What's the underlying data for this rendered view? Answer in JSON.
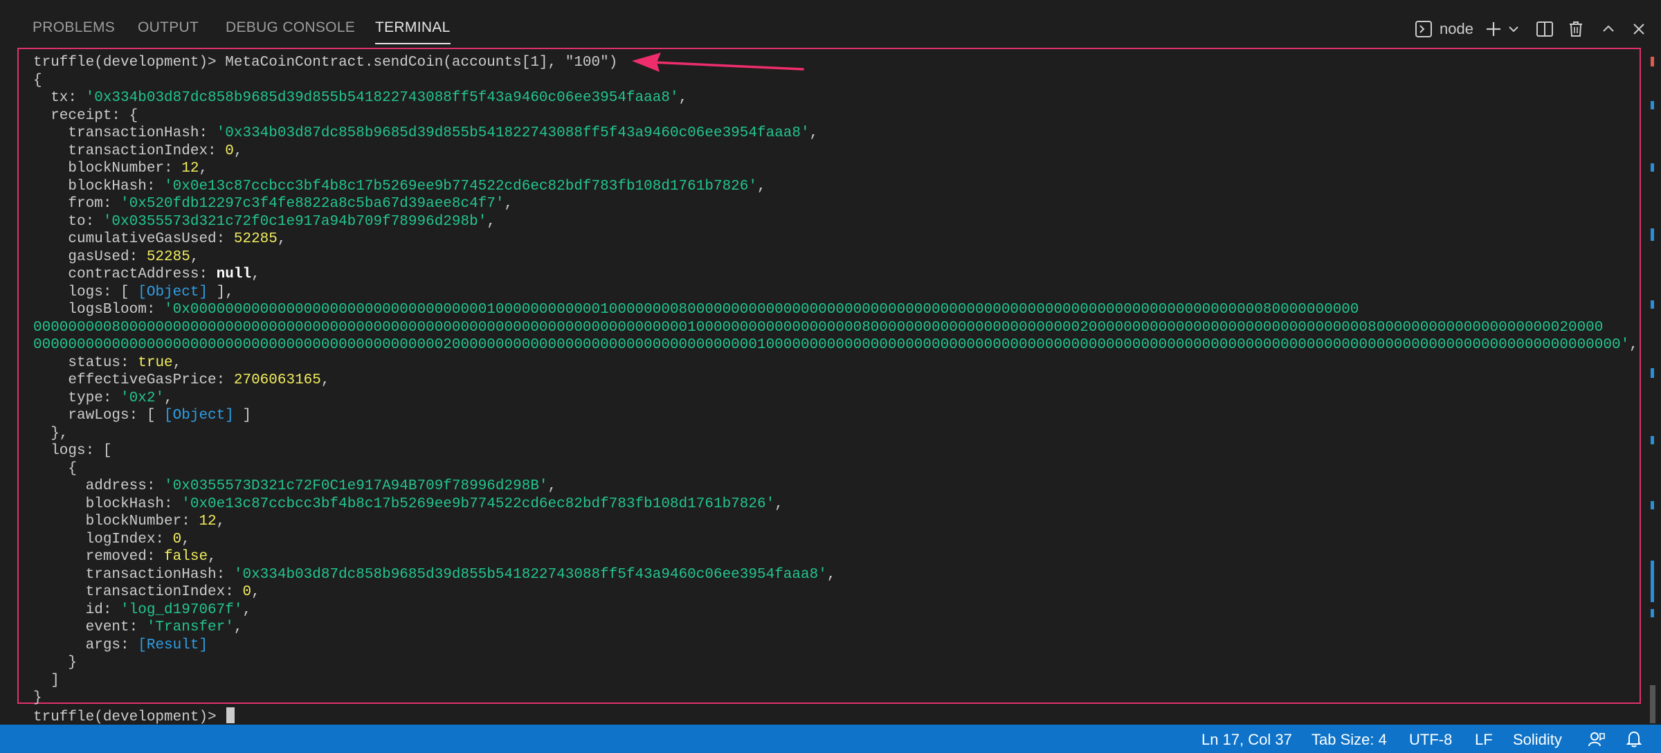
{
  "panel": {
    "tabs": [
      "Problems",
      "Output",
      "Debug Console",
      "Terminal"
    ],
    "active_tab": "Terminal",
    "terminal_name": "node"
  },
  "terminal": {
    "lines": [
      [
        [
          "p",
          "truffle(development)> MetaCoinContract.sendCoin(accounts[1], \"100\")"
        ]
      ],
      [
        [
          "p",
          "{"
        ]
      ],
      [
        [
          "p",
          "  tx: "
        ],
        [
          "s",
          "'0x334b03d87dc858b9685d39d855b541822743088ff5f43a9460c06ee3954faaa8'"
        ],
        [
          "p",
          ","
        ]
      ],
      [
        [
          "p",
          "  receipt: {"
        ]
      ],
      [
        [
          "p",
          "    transactionHash: "
        ],
        [
          "s",
          "'0x334b03d87dc858b9685d39d855b541822743088ff5f43a9460c06ee3954faaa8'"
        ],
        [
          "p",
          ","
        ]
      ],
      [
        [
          "p",
          "    transactionIndex: "
        ],
        [
          "n",
          "0"
        ],
        [
          "p",
          ","
        ]
      ],
      [
        [
          "p",
          "    blockNumber: "
        ],
        [
          "n",
          "12"
        ],
        [
          "p",
          ","
        ]
      ],
      [
        [
          "p",
          "    blockHash: "
        ],
        [
          "s",
          "'0x0e13c87ccbcc3bf4b8c17b5269ee9b774522cd6ec82bdf783fb108d1761b7826'"
        ],
        [
          "p",
          ","
        ]
      ],
      [
        [
          "p",
          "    from: "
        ],
        [
          "s",
          "'0x520fdb12297c3f4fe8822a8c5ba67d39aee8c4f7'"
        ],
        [
          "p",
          ","
        ]
      ],
      [
        [
          "p",
          "    to: "
        ],
        [
          "s",
          "'0x0355573d321c72f0c1e917a94b709f78996d298b'"
        ],
        [
          "p",
          ","
        ]
      ],
      [
        [
          "p",
          "    cumulativeGasUsed: "
        ],
        [
          "n",
          "52285"
        ],
        [
          "p",
          ","
        ]
      ],
      [
        [
          "p",
          "    gasUsed: "
        ],
        [
          "n",
          "52285"
        ],
        [
          "p",
          ","
        ]
      ],
      [
        [
          "p",
          "    contractAddress: "
        ],
        [
          "k",
          "null"
        ],
        [
          "p",
          ","
        ]
      ],
      [
        [
          "p",
          "    logs: [ "
        ],
        [
          "o",
          "[Object]"
        ],
        [
          "p",
          " ],"
        ]
      ],
      [
        [
          "p",
          "    logsBloom: "
        ],
        [
          "s",
          "'0x00000000000000000000000000000000001000000000000100000000800000000000000000000000000000000000000000000000000000000000000000080000000000"
        ]
      ],
      [
        [
          "s",
          "000000000800000000000000000000000000000000000000000000000000000000000000000100000000000000000008000000000000000000000000200000000000000000000000000000000800000000000000000000020000"
        ]
      ],
      [
        [
          "s",
          "00000000000000000000000000000000000000000000000200000000000000000000000000000000000100000000000000000000000000000000000000000000000000000000000000000000000000000000000000000000000000'"
        ],
        [
          "p",
          ","
        ]
      ],
      [
        [
          "p",
          "    status: "
        ],
        [
          "n",
          "true"
        ],
        [
          "p",
          ","
        ]
      ],
      [
        [
          "p",
          "    effectiveGasPrice: "
        ],
        [
          "n",
          "2706063165"
        ],
        [
          "p",
          ","
        ]
      ],
      [
        [
          "p",
          "    type: "
        ],
        [
          "s",
          "'0x2'"
        ],
        [
          "p",
          ","
        ]
      ],
      [
        [
          "p",
          "    rawLogs: [ "
        ],
        [
          "o",
          "[Object]"
        ],
        [
          "p",
          " ]"
        ]
      ],
      [
        [
          "p",
          "  },"
        ]
      ],
      [
        [
          "p",
          "  logs: ["
        ]
      ],
      [
        [
          "p",
          "    {"
        ]
      ],
      [
        [
          "p",
          "      address: "
        ],
        [
          "s",
          "'0x0355573D321c72F0C1e917A94B709f78996d298B'"
        ],
        [
          "p",
          ","
        ]
      ],
      [
        [
          "p",
          "      blockHash: "
        ],
        [
          "s",
          "'0x0e13c87ccbcc3bf4b8c17b5269ee9b774522cd6ec82bdf783fb108d1761b7826'"
        ],
        [
          "p",
          ","
        ]
      ],
      [
        [
          "p",
          "      blockNumber: "
        ],
        [
          "n",
          "12"
        ],
        [
          "p",
          ","
        ]
      ],
      [
        [
          "p",
          "      logIndex: "
        ],
        [
          "n",
          "0"
        ],
        [
          "p",
          ","
        ]
      ],
      [
        [
          "p",
          "      removed: "
        ],
        [
          "n",
          "false"
        ],
        [
          "p",
          ","
        ]
      ],
      [
        [
          "p",
          "      transactionHash: "
        ],
        [
          "s",
          "'0x334b03d87dc858b9685d39d855b541822743088ff5f43a9460c06ee3954faaa8'"
        ],
        [
          "p",
          ","
        ]
      ],
      [
        [
          "p",
          "      transactionIndex: "
        ],
        [
          "n",
          "0"
        ],
        [
          "p",
          ","
        ]
      ],
      [
        [
          "p",
          "      id: "
        ],
        [
          "s",
          "'log_d197067f'"
        ],
        [
          "p",
          ","
        ]
      ],
      [
        [
          "p",
          "      event: "
        ],
        [
          "s",
          "'Transfer'"
        ],
        [
          "p",
          ","
        ]
      ],
      [
        [
          "p",
          "      args: "
        ],
        [
          "o",
          "[Result]"
        ]
      ],
      [
        [
          "p",
          "    }"
        ]
      ],
      [
        [
          "p",
          "  ]"
        ]
      ],
      [
        [
          "p",
          "}"
        ]
      ]
    ],
    "prompt": "truffle(development)> "
  },
  "statusbar": {
    "cursor_position": "Ln 17, Col 37",
    "tab_size": "Tab Size: 4",
    "encoding": "UTF-8",
    "line_ending": "LF",
    "language": "Solidity"
  },
  "colors": {
    "accent": "#0e73c9",
    "highlight_box": "#e0316a",
    "string": "#23c58e",
    "number": "#f2ed5f",
    "object": "#2e9fe6"
  }
}
